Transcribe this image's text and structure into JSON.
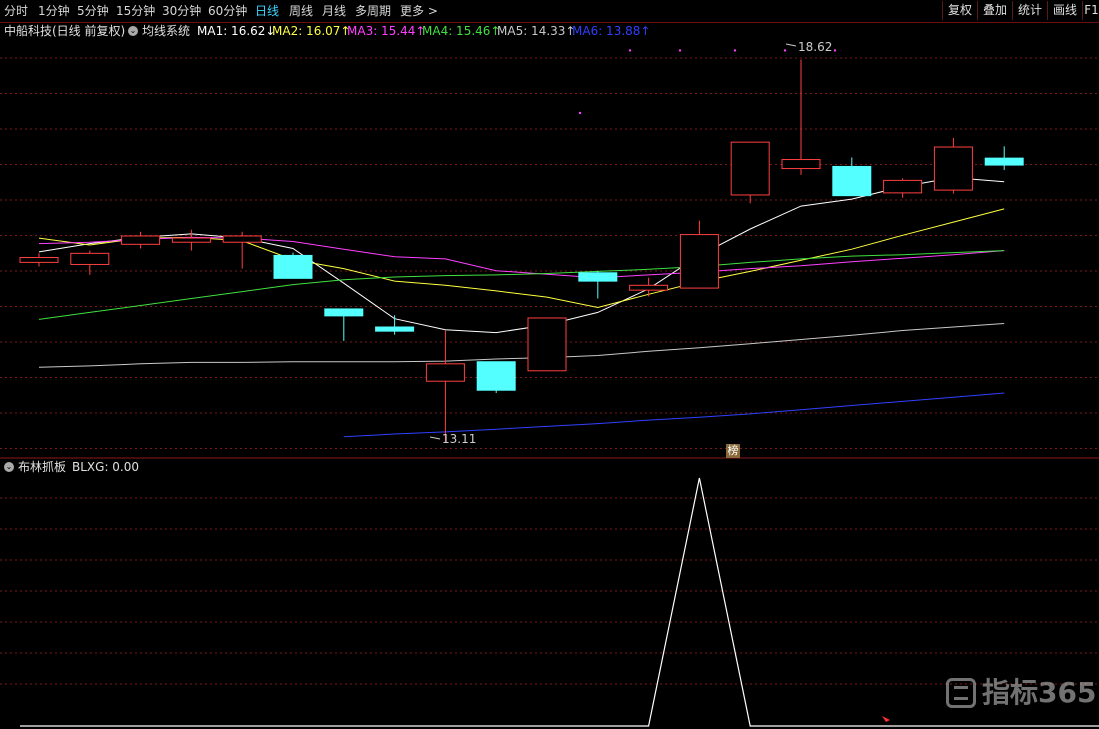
{
  "toolbar": {
    "periods": [
      "分时",
      "1分钟",
      "5分钟",
      "15分钟",
      "30分钟",
      "60分钟",
      "日线",
      "周线",
      "月线",
      "多周期",
      "更多 >"
    ],
    "active_period": "日线",
    "right_buttons": [
      "复权",
      "叠加",
      "统计",
      "画线",
      "F1"
    ]
  },
  "main_info": {
    "stock": "中船科技(日线 前复权)",
    "indicator_name": "均线系统",
    "ma1": "MA1: 16.62↓",
    "ma2": "MA2: 16.07↑",
    "ma3": "MA3: 15.44↑",
    "ma4": "MA4: 15.46↑",
    "ma5": "MA5: 14.33↑",
    "ma6": "MA6: 13.88↑"
  },
  "sub_info": {
    "indicator": "布林抓板",
    "value": "BLXG: 0.00"
  },
  "annotations": {
    "high": "18.62",
    "low": "13.11",
    "bang_label": "榜"
  },
  "watermark": {
    "text": "指标365"
  },
  "colors": {
    "up": "#ff4040",
    "down": "#54ffff",
    "ma1": "#ffffff",
    "ma2": "#ffff40",
    "ma3": "#ff40ff",
    "ma4": "#40e040",
    "ma5": "#c8c8c8",
    "ma6": "#3040ff",
    "grid": "#7a1a1a",
    "sub_line": "#ffffff"
  },
  "chart_data": {
    "type": "candlestick",
    "price_range": [
      13.0,
      18.9
    ],
    "candles": [
      {
        "open": 15.7,
        "close": 15.77,
        "high": 15.83,
        "low": 15.64
      },
      {
        "open": 15.67,
        "close": 15.83,
        "high": 15.87,
        "low": 15.52
      },
      {
        "open": 15.96,
        "close": 16.08,
        "high": 16.14,
        "low": 15.9
      },
      {
        "open": 15.99,
        "close": 16.05,
        "high": 16.17,
        "low": 15.87
      },
      {
        "open": 15.99,
        "close": 16.08,
        "high": 16.14,
        "low": 15.61
      },
      {
        "open": 15.8,
        "close": 15.47,
        "high": 15.84,
        "low": 15.47
      },
      {
        "open": 15.03,
        "close": 14.93,
        "high": 15.03,
        "low": 14.57
      },
      {
        "open": 14.77,
        "close": 14.71,
        "high": 14.94,
        "low": 14.66
      },
      {
        "open": 13.99,
        "close": 14.24,
        "high": 14.72,
        "low": 13.11
      },
      {
        "open": 14.27,
        "close": 13.86,
        "high": 14.27,
        "low": 13.82
      },
      {
        "open": 14.14,
        "close": 14.9,
        "high": 14.9,
        "low": 14.14
      },
      {
        "open": 15.55,
        "close": 15.43,
        "high": 15.58,
        "low": 15.18
      },
      {
        "open": 15.3,
        "close": 15.37,
        "high": 15.48,
        "low": 15.21
      },
      {
        "open": 15.33,
        "close": 16.1,
        "high": 16.3,
        "low": 15.33
      },
      {
        "open": 16.67,
        "close": 17.43,
        "high": 17.43,
        "low": 16.55
      },
      {
        "open": 17.05,
        "close": 17.18,
        "high": 18.62,
        "low": 16.96
      },
      {
        "open": 17.08,
        "close": 16.66,
        "high": 17.21,
        "low": 16.66
      },
      {
        "open": 16.7,
        "close": 16.88,
        "high": 16.91,
        "low": 16.63
      },
      {
        "open": 16.74,
        "close": 17.36,
        "high": 17.49,
        "low": 16.69
      },
      {
        "open": 17.2,
        "close": 17.1,
        "high": 17.37,
        "low": 17.03
      }
    ],
    "ma1": [
      15.85,
      15.97,
      16.06,
      16.11,
      16.05,
      15.9,
      15.4,
      14.89,
      14.73,
      14.69,
      14.8,
      14.98,
      15.32,
      15.8,
      16.18,
      16.51,
      16.61,
      16.79,
      16.92,
      16.86
    ],
    "ma2": [
      16.05,
      15.95,
      16.05,
      16.06,
      16.01,
      15.74,
      15.61,
      15.43,
      15.37,
      15.29,
      15.2,
      15.05,
      15.24,
      15.42,
      15.57,
      15.73,
      15.89,
      16.09,
      16.28,
      16.47
    ],
    "ma3": [
      15.97,
      15.99,
      16.03,
      16.06,
      16.05,
      16.0,
      15.89,
      15.78,
      15.75,
      15.58,
      15.53,
      15.48,
      15.52,
      15.56,
      15.61,
      15.65,
      15.71,
      15.76,
      15.81,
      15.87
    ],
    "ma4": [
      14.88,
      14.98,
      15.08,
      15.18,
      15.28,
      15.38,
      15.45,
      15.49,
      15.51,
      15.52,
      15.54,
      15.57,
      15.6,
      15.64,
      15.7,
      15.75,
      15.79,
      15.81,
      15.84,
      15.87
    ],
    "ma5": [
      14.19,
      14.21,
      14.24,
      14.26,
      14.26,
      14.27,
      14.27,
      14.27,
      14.28,
      14.31,
      14.33,
      14.36,
      14.42,
      14.47,
      14.53,
      14.59,
      14.65,
      14.72,
      14.77,
      14.82
    ],
    "ma6": [
      null,
      null,
      null,
      null,
      null,
      null,
      13.19,
      13.23,
      13.26,
      13.3,
      13.34,
      13.38,
      13.43,
      13.47,
      13.52,
      13.58,
      13.64,
      13.7,
      13.76,
      13.82
    ],
    "ma_dots": [
      17.85,
      18.75,
      18.75,
      18.75,
      18.75,
      18.75
    ],
    "sub_series": [
      0,
      0,
      0,
      0,
      0,
      0,
      0,
      0,
      0,
      0,
      0,
      0,
      0,
      1,
      0,
      0,
      0,
      0,
      0,
      0
    ],
    "sub_range": [
      0,
      1
    ]
  }
}
